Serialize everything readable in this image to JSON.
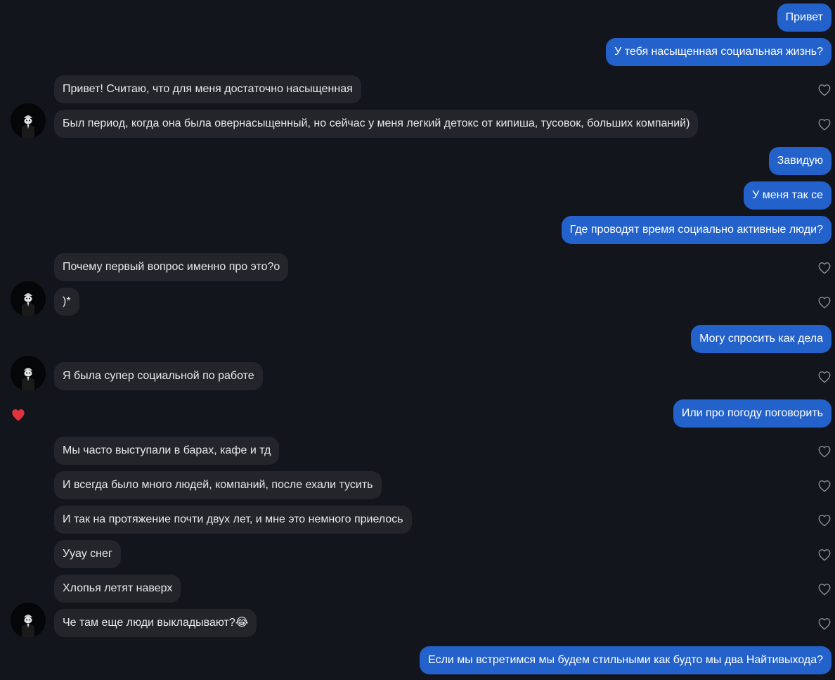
{
  "chat": {
    "messages": [
      {
        "from": "me",
        "text": "Привет"
      },
      {
        "from": "me",
        "text": "У тебя насыщенная социальная жизнь?"
      },
      {
        "from": "them",
        "text": "Привет! Считаю, что для меня достаточно насыщенная"
      },
      {
        "from": "them",
        "text": "Был период, когда она была овернасыщенный, но сейчас у меня легкий детокс от кипиша, тусовок, больших компаний)"
      },
      {
        "from": "me",
        "text": "Завидую"
      },
      {
        "from": "me",
        "text": "У меня так се"
      },
      {
        "from": "me",
        "text": "Где проводят время социально активные люди?"
      },
      {
        "from": "them",
        "text": "Почему первый вопрос именно про это?о"
      },
      {
        "from": "them",
        "text": ")*"
      },
      {
        "from": "me",
        "text": "Могу спросить как дела"
      },
      {
        "from": "them",
        "text": "Я была супер социальной по работе"
      },
      {
        "from": "me",
        "text": "Или про погоду поговорить"
      },
      {
        "from": "them",
        "text": "Мы часто выступали в барах, кафе и тд"
      },
      {
        "from": "them",
        "text": "И всегда было много людей, компаний, после ехали тусить"
      },
      {
        "from": "them",
        "text": "И так на протяжение почти двух лет, и мне это немного приелось"
      },
      {
        "from": "them",
        "text": "Ууау снег"
      },
      {
        "from": "them",
        "text": "Хлопья летят наверх"
      },
      {
        "from": "them",
        "text": "Че там еще люди выкладывают?😂"
      },
      {
        "from": "me",
        "text": "Если мы встретимся мы будем стильными как будто мы два Найтивыхода?"
      }
    ]
  },
  "icons": {
    "like": "heart-outline-icon",
    "reaction": "heart-filled-icon",
    "avatar": "contact-avatar"
  },
  "colors": {
    "background": "#12151b",
    "incoming_bubble": "#23252b",
    "outgoing_bubble": "#2361cb",
    "reaction_heart": "#e0323c"
  }
}
